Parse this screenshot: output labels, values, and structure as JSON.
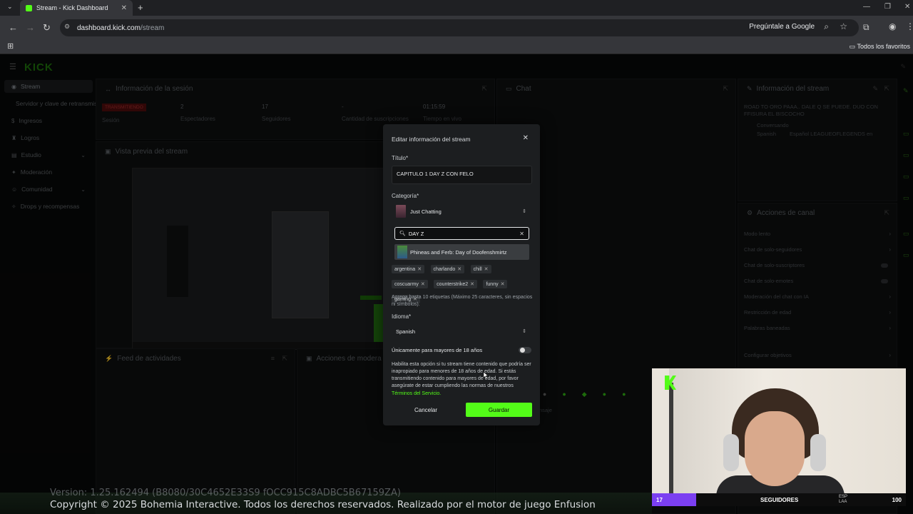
{
  "browser": {
    "tab_title": "Stream - Kick Dashboard",
    "url_host": "dashboard.kick.com",
    "url_path": "/stream",
    "ask_google": "Pregúntale a Google",
    "bookmarks_label": "Todos los favoritos"
  },
  "app": {
    "logo": "KICK"
  },
  "sidebar": {
    "items": [
      {
        "label": "Stream",
        "icon": "broadcast-icon"
      },
      {
        "label": "Servidor y clave de retransmisión",
        "icon": ""
      },
      {
        "label": "Ingresos",
        "icon": "dollar-icon"
      },
      {
        "label": "Logros",
        "icon": "trophy-icon"
      },
      {
        "label": "Estudio",
        "icon": "studio-icon"
      },
      {
        "label": "Moderación",
        "icon": "shield-icon"
      },
      {
        "label": "Comunidad",
        "icon": "people-icon"
      },
      {
        "label": "Drops y recompensas",
        "icon": "gift-icon"
      }
    ]
  },
  "session": {
    "title": "Información de la sesión",
    "status_badge": "TRANSMITIENDO",
    "status_label": "Sesión",
    "stats": [
      {
        "value": "2",
        "label": "Espectadores"
      },
      {
        "value": "17",
        "label": "Seguidores"
      },
      {
        "value": "-",
        "label": "Cantidad de suscripciones"
      },
      {
        "value": "01:15:59",
        "label": "Tiempo en vivo"
      }
    ]
  },
  "preview": {
    "title": "Vista previa del stream"
  },
  "activity": {
    "title": "Feed de actividades"
  },
  "mod_actions": {
    "title": "Acciones de modera"
  },
  "chat": {
    "title": "Chat",
    "input_placeholder": "Envíale un mensaje"
  },
  "stream_info": {
    "title": "Información del stream",
    "stream_title": "ROAD TO ORO PAAA.. DALE Q SE PUEDE. DUO CON FFISURA EL BISCOCHO",
    "category": "Conversando",
    "language": "Spanish",
    "tags_row": "Español   LEAGUEOFLEGENDS   en"
  },
  "channel_actions": {
    "title": "Acciones de canal",
    "items": [
      {
        "label": "Modo lento",
        "kind": "chevron"
      },
      {
        "label": "Chat de solo-seguidores",
        "kind": "chevron"
      },
      {
        "label": "Chat de solo-suscriptores",
        "kind": "toggle"
      },
      {
        "label": "Chat de solo-emotes",
        "kind": "toggle"
      },
      {
        "label": "Moderación del chat con IA",
        "kind": "chevron"
      },
      {
        "label": "Restricción de edad",
        "kind": "chevron"
      },
      {
        "label": "Palabras baneadas",
        "kind": "chevron"
      },
      {
        "label": "Configurar objetivos",
        "kind": "chevron"
      }
    ]
  },
  "modal": {
    "title": "Editar información del stream",
    "title_label": "Título*",
    "title_value": "CAPITULO 1 DAY Z CON FELO",
    "category_label": "Categoría*",
    "category_value": "Just Chatting",
    "search_value": "DAY Z",
    "search_result": "Phineas and Ferb: Day of Doofenshmirtz",
    "tags": [
      "argentina",
      "charlando",
      "chill",
      "coscuarmy",
      "counterstrike2",
      "funny",
      "gaming"
    ],
    "tags_hint": "Agrega hasta 10 etiquetas (Máximo 25 caracteres, sin espacios ni símbolos).",
    "language_label": "Idioma*",
    "language_value": "Spanish",
    "adult_label": "Únicamente para mayores de 18 años",
    "adult_desc": "Habilita esta opción si tu stream tiene contenido que podría ser inapropiado para menores de 18 años de edad. Si estás transmitiendo contenido para mayores de edad, por favor asegúrate de estar cumpliendo las normas de nuestros ",
    "terms_link": "Términos del Servicio.",
    "cancel_label": "Cancelar",
    "save_label": "Guardar"
  },
  "overlay": {
    "follower_count": "17",
    "followers_label": "SEGUIDORES",
    "goal": "100",
    "lang": "ESP",
    "lang2": "LAA"
  },
  "game": {
    "version": "Version: 1.25.162494 (B8080/30C4652E33S9 fOCC915C8ADBC5B67159ZA)",
    "copyright": "Copyright © 2025 Bohemia Interactive. Todos los derechos reservados. Realizado por el motor de juego Enfusion"
  },
  "colors": {
    "accent": "#53fc18",
    "live": "#9b2a2a",
    "followers_bar": "#7b3ff2"
  }
}
